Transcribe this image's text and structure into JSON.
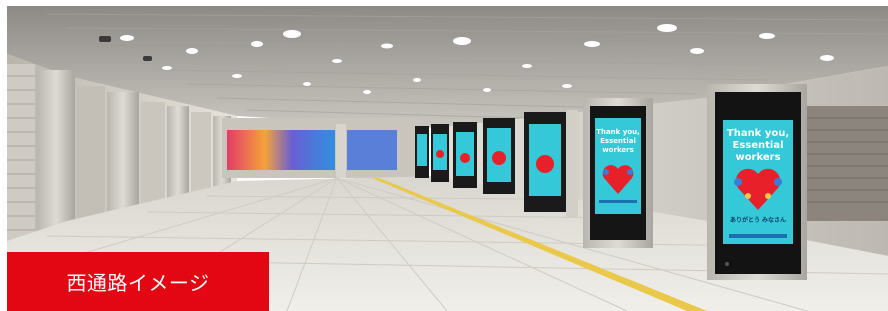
{
  "caption": {
    "label": "西通路イメージ"
  },
  "signage": {
    "headline": [
      "Thank you,",
      "Essential",
      "workers"
    ],
    "subline": "ありがとう みなさん"
  },
  "colors": {
    "caption_bg": "#e30613",
    "caption_text": "#ffffff",
    "screen_bg": "#35c8d8",
    "heart": "#e8202a",
    "pillar": "#d6d4cf",
    "floor": "#e9e6df",
    "guide_line": "#e9c84a"
  }
}
